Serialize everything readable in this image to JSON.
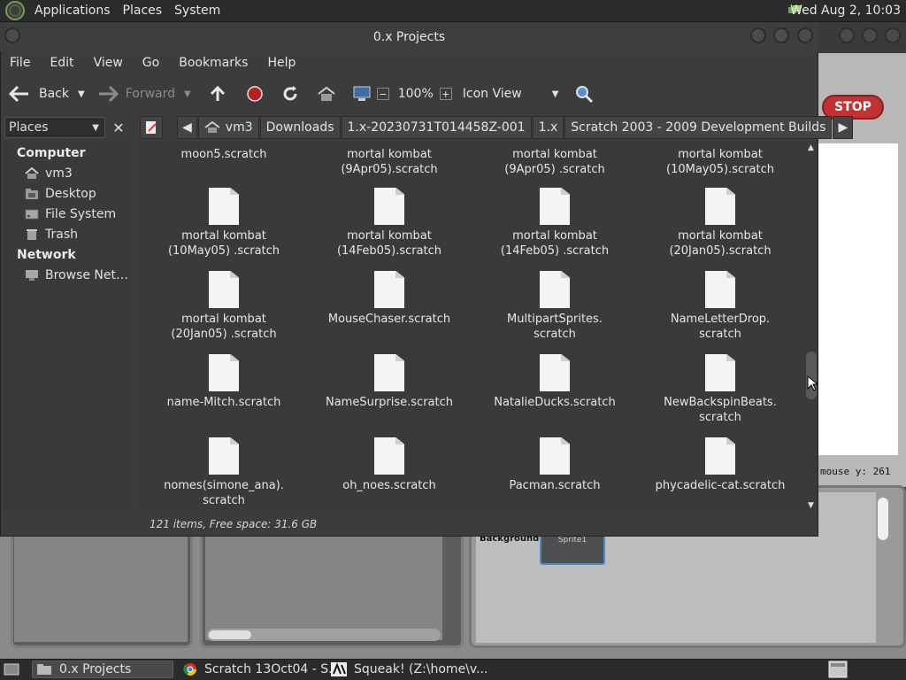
{
  "top_panel": {
    "menus": [
      "Applications",
      "Places",
      "System"
    ],
    "clock": "Wed Aug  2, 10:03"
  },
  "scratch": {
    "stop_label": "STOP",
    "mouse_y": "mouse y: 261",
    "background_label": "Background",
    "sprite_label": "Sprite1"
  },
  "window": {
    "title": "0.x Projects",
    "menus": [
      "File",
      "Edit",
      "View",
      "Go",
      "Bookmarks",
      "Help"
    ],
    "toolbar": {
      "back": "Back",
      "forward": "Forward",
      "zoom": "100%",
      "view_mode": "Icon View"
    },
    "places_combo": "Places",
    "breadcrumbs": [
      "vm3",
      "Downloads",
      "1.x-20230731T014458Z-001",
      "1.x",
      "Scratch 2003 - 2009 Development Builds"
    ],
    "sidebar": {
      "computer_header": "Computer",
      "computer_items": [
        "vm3",
        "Desktop",
        "File System",
        "Trash"
      ],
      "network_header": "Network",
      "network_items": [
        "Browse Net…"
      ]
    },
    "files": [
      {
        "l1": "moon5.scratch",
        "l2": ""
      },
      {
        "l1": "mortal kombat",
        "l2": "(9Apr05).scratch"
      },
      {
        "l1": "mortal kombat",
        "l2": "(9Apr05) .scratch"
      },
      {
        "l1": "mortal kombat",
        "l2": "(10May05).scratch"
      },
      {
        "l1": "mortal kombat",
        "l2": "(10May05) .scratch"
      },
      {
        "l1": "mortal kombat",
        "l2": "(14Feb05).scratch"
      },
      {
        "l1": "mortal kombat",
        "l2": "(14Feb05) .scratch"
      },
      {
        "l1": "mortal kombat",
        "l2": "(20Jan05).scratch"
      },
      {
        "l1": "mortal kombat",
        "l2": "(20Jan05) .scratch"
      },
      {
        "l1": "MouseChaser.scratch",
        "l2": ""
      },
      {
        "l1": "MultipartSprites.",
        "l2": "scratch"
      },
      {
        "l1": "NameLetterDrop.",
        "l2": "scratch"
      },
      {
        "l1": "name-Mitch.scratch",
        "l2": ""
      },
      {
        "l1": "NameSurprise.scratch",
        "l2": ""
      },
      {
        "l1": "NatalieDucks.scratch",
        "l2": ""
      },
      {
        "l1": "NewBackspinBeats.",
        "l2": "scratch"
      },
      {
        "l1": "nomes(simone_ana).",
        "l2": "scratch"
      },
      {
        "l1": "oh_noes.scratch",
        "l2": ""
      },
      {
        "l1": "Pacman.scratch",
        "l2": ""
      },
      {
        "l1": "phycadelic-cat.scratch",
        "l2": ""
      }
    ],
    "status": "121 items, Free space: 31.6 GB"
  },
  "taskbar": {
    "items": [
      "0.x Projects",
      "Scratch 13Oct04 - S...",
      "Squeak! (Z:\\home\\v..."
    ]
  }
}
